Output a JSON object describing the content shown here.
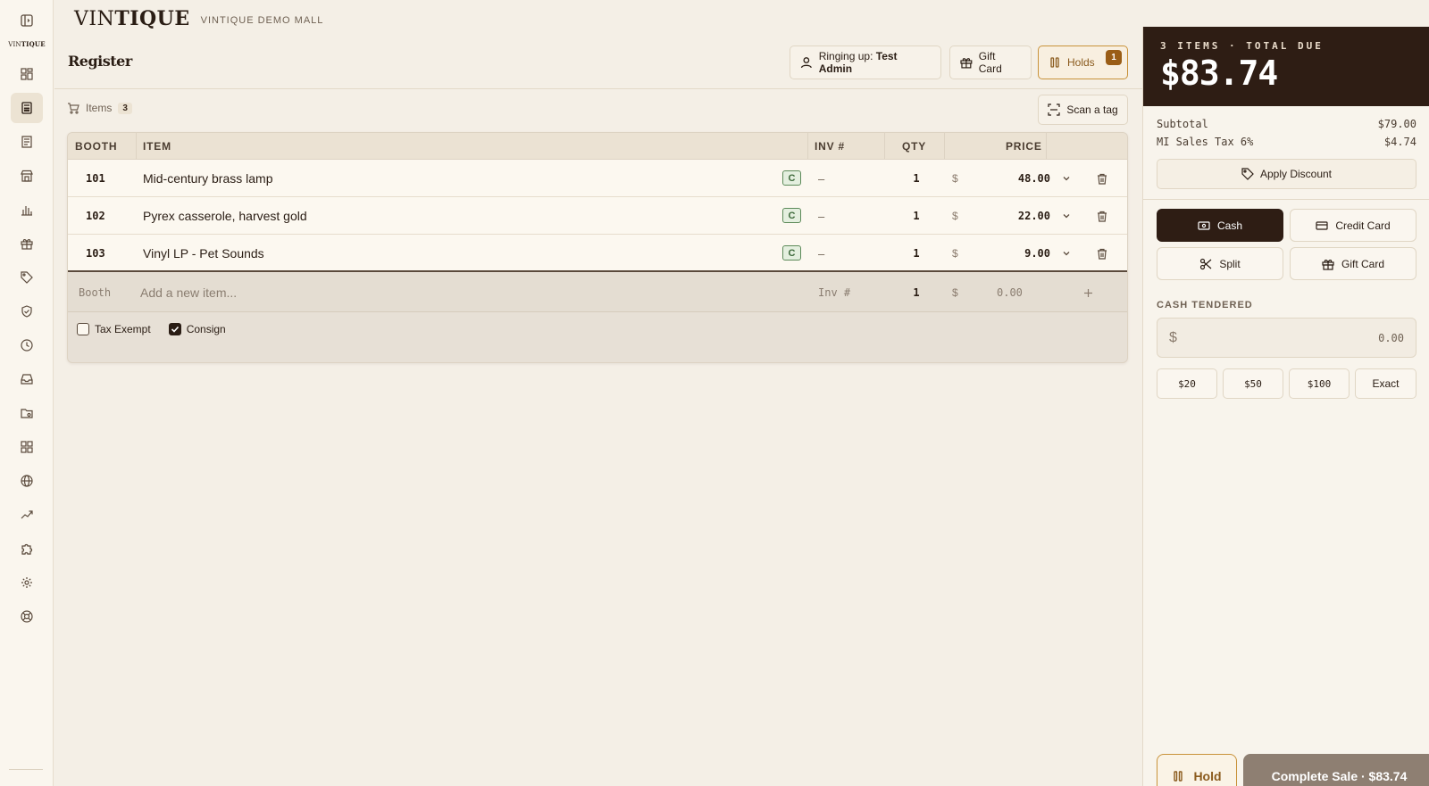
{
  "app": {
    "logo_pre": "VIN",
    "logo_bold": "TIQUE",
    "mini_logo_pre": "VIN",
    "mini_logo_bold": "TIQUE",
    "mall_name": "VINTIQUE DEMO MALL"
  },
  "sidebar": {
    "icons": [
      "sidebar-toggle-icon",
      "dashboard-icon",
      "register-icon",
      "receipt-icon",
      "store-icon",
      "bar-chart-icon",
      "gift-icon",
      "tag-icon",
      "shield-check-icon",
      "clock-icon",
      "inbox-icon",
      "folder-icon",
      "apps-grid-icon",
      "globe-icon",
      "trending-up-icon",
      "puzzle-icon",
      "gear-icon",
      "lifebuoy-icon"
    ],
    "active": "register-icon"
  },
  "header": {
    "title": "Register",
    "ringing_label": "Ringing up:",
    "ringing_user": "Test Admin",
    "gift_card_label": "Gift Card",
    "holds_label": "Holds",
    "holds_count": "1"
  },
  "items_bar": {
    "label": "Items",
    "count": "3",
    "scan_label": "Scan a tag"
  },
  "table": {
    "headers": {
      "booth": "BOOTH",
      "item": "ITEM",
      "inv": "INV #",
      "qty": "QTY",
      "price": "PRICE"
    },
    "rows": [
      {
        "booth": "101",
        "item": "Mid-century brass lamp",
        "badge": "C",
        "inv": "–",
        "qty": "1",
        "currency": "$",
        "price": "48.00"
      },
      {
        "booth": "102",
        "item": "Pyrex casserole, harvest gold",
        "badge": "C",
        "inv": "–",
        "qty": "1",
        "currency": "$",
        "price": "22.00"
      },
      {
        "booth": "103",
        "item": "Vinyl LP - Pet Sounds",
        "badge": "C",
        "inv": "–",
        "qty": "1",
        "currency": "$",
        "price": "9.00"
      }
    ],
    "new_row": {
      "booth_placeholder": "Booth",
      "item_placeholder": "Add a new item...",
      "inv_placeholder": "Inv #",
      "qty": "1",
      "currency": "$",
      "price_placeholder": "0.00"
    },
    "options": {
      "tax_exempt_label": "Tax Exempt",
      "tax_exempt_checked": false,
      "consign_label": "Consign",
      "consign_checked": true
    }
  },
  "summary": {
    "header": "3 ITEMS · TOTAL DUE",
    "total": "$83.74",
    "subtotal_label": "Subtotal",
    "subtotal_value": "$79.00",
    "tax_label": "MI Sales Tax 6%",
    "tax_value": "$4.74",
    "discount_label": "Apply Discount"
  },
  "payment": {
    "methods": [
      "Cash",
      "Credit Card",
      "Split",
      "Gift Card"
    ],
    "selected": "Cash",
    "cash_tendered_label": "CASH TENDERED",
    "currency": "$",
    "tendered_value": "0.00",
    "quick_amounts": [
      "$20",
      "$50",
      "$100",
      "Exact"
    ]
  },
  "actions": {
    "hold_label": "Hold",
    "complete_label": "Complete Sale · $83.74"
  },
  "colors": {
    "accent_dark": "#2e1d14",
    "holds_accent": "#c8923a",
    "consign_badge": "#3f6b3c",
    "complete_disabled": "#8e7f72",
    "background": "#f4efe6"
  }
}
